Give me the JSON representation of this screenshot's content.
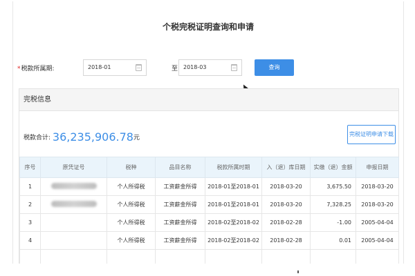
{
  "page_title": "个税完税证明查询和申请",
  "query": {
    "required_mark": "*",
    "period_label": "税款所属期:",
    "start_value": "2018-01",
    "to_label": "至",
    "end_value": "2018-03",
    "query_button": "查询"
  },
  "panel": {
    "title": "完税信息",
    "total_label": "税款合计:",
    "total_amount": "36,235,906.78",
    "total_unit": "元",
    "download_button": "完税证明申请下载"
  },
  "table": {
    "headers": [
      "序号",
      "原凭证号",
      "税种",
      "品目名称",
      "税款所属时期",
      "入（退）库日期",
      "实缴（退）金额",
      "申报日期"
    ],
    "rows": [
      {
        "index": "1",
        "voucher": "",
        "tax_type": "个人所得税",
        "item": "工资薪金所得",
        "period": "2018-01至2018-01",
        "stock_date": "2018-03-20",
        "amount": "3,675.50",
        "declare_date": "2018-03-20"
      },
      {
        "index": "2",
        "voucher": "",
        "tax_type": "个人所得税",
        "item": "工资薪金所得",
        "period": "2018-01至2018-01",
        "stock_date": "2018-03-20",
        "amount": "7,328.25",
        "declare_date": "2018-03-20"
      },
      {
        "index": "3",
        "voucher": "",
        "tax_type": "个人所得税",
        "item": "工资薪金所得",
        "period": "2018-02至2018-02",
        "stock_date": "2018-02-28",
        "amount": "-1.00",
        "declare_date": "2005-04-04"
      },
      {
        "index": "4",
        "voucher": "",
        "tax_type": "个人所得税",
        "item": "工资薪金所得",
        "period": "2018-02至2018-02",
        "stock_date": "2018-02-28",
        "amount": "0.01",
        "declare_date": "2005-04-04"
      }
    ]
  },
  "colors": {
    "accent": "#3d8ee6",
    "required": "#e02020",
    "table_header_bg": "#eaf4fb"
  }
}
